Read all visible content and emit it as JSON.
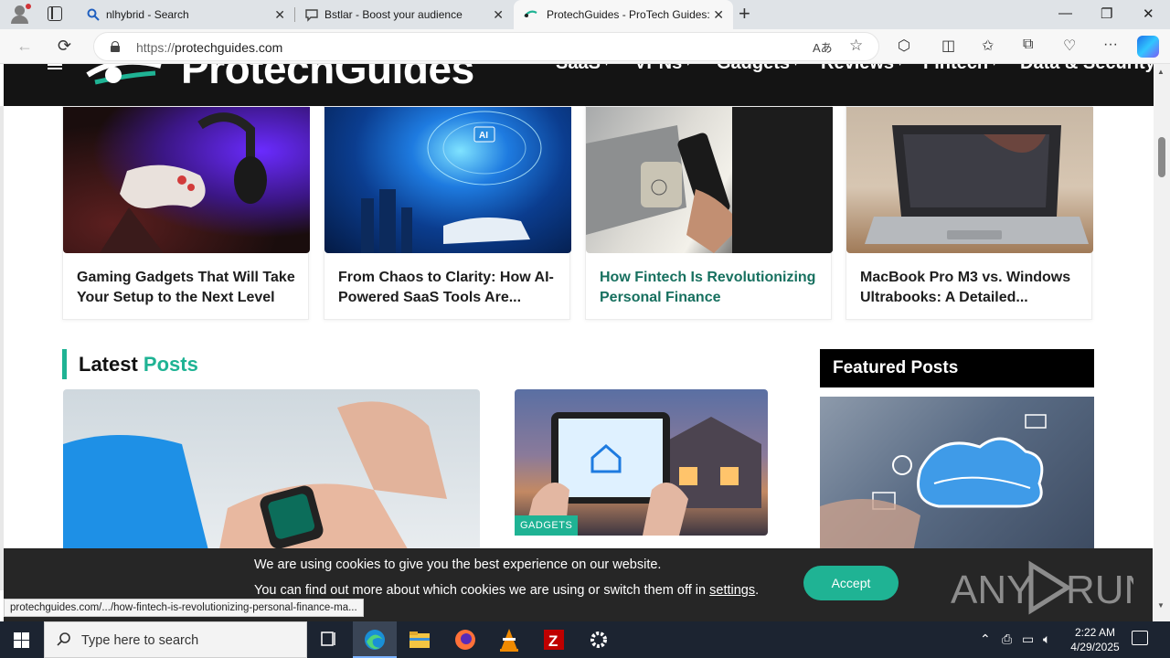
{
  "browser": {
    "tabs": [
      {
        "label": "nlhybrid - Search"
      },
      {
        "label": "Bstlar - Boost your audience"
      },
      {
        "label": "ProtechGuides - ProTech Guides: Yo"
      }
    ],
    "url_prefix": "https://",
    "url_host": "protechguides.com",
    "status_url": "protechguides.com/.../how-fintech-is-revolutionizing-personal-finance-ma..."
  },
  "site": {
    "logo_text": "ProtechGuides",
    "menu": [
      "SaaS",
      "VPNs",
      "Gadgets",
      "Reviews",
      "Fintech",
      "Data & Security"
    ],
    "cards": [
      {
        "title": "Gaming Gadgets That Will Take Your Setup to the Next Level"
      },
      {
        "title": "From Chaos to Clarity: How AI-Powered SaaS Tools Are..."
      },
      {
        "title": "How Fintech Is Revolutionizing Personal Finance Management..."
      },
      {
        "title": "MacBook Pro M3 vs. Windows Ultrabooks: A Detailed..."
      }
    ],
    "latest": {
      "word1": "Latest",
      "word2": "Posts",
      "badge": "GADGETS"
    },
    "featured": {
      "heading": "Featured Posts"
    }
  },
  "cookie": {
    "line1": "We are using cookies to give you the best experience on our website.",
    "line2_pre": "You can find out more about which cookies we are using or switch them off in",
    "line2_link": "settings",
    "line2_post": ".",
    "accept": "Accept"
  },
  "watermark": "ANY RUN",
  "taskbar": {
    "search_placeholder": "Type here to search",
    "time": "2:22 AM",
    "date": "4/29/2025"
  },
  "colors": {
    "accent": "#1fb394",
    "header_bg": "#141414",
    "taskbar": "#1c2431"
  }
}
